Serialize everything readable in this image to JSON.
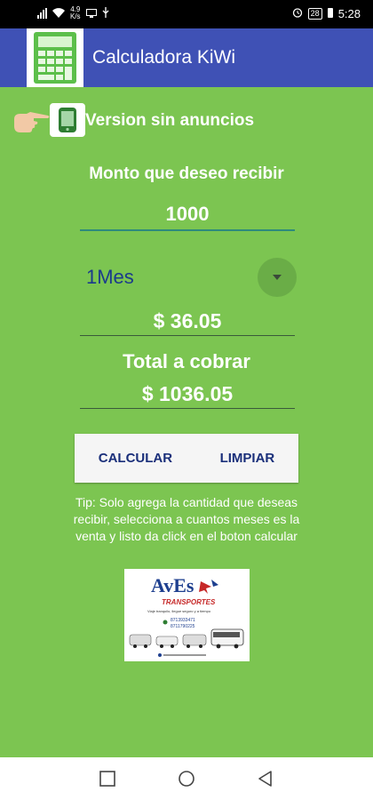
{
  "status_bar": {
    "netspeed_value": "4.9",
    "netspeed_unit": "K/s",
    "battery": "28",
    "time": "5:28"
  },
  "app_bar": {
    "title": "Calculadora KiWi",
    "color": "#3f51b5",
    "icon": "calculator-icon"
  },
  "ad_free": {
    "label": "Version sin anuncios",
    "icons": [
      "pointing-hand-icon",
      "phone-icon"
    ]
  },
  "form": {
    "amount_label": "Monto que deseo recibir",
    "amount_value": "1000",
    "months_selected": "1Mes",
    "interest": "$ 36.05",
    "total_label": "Total a cobrar",
    "total": "$ 1036.05"
  },
  "buttons": {
    "calculate": "CALCULAR",
    "clear": "LIMPIAR"
  },
  "tip": "Tip: Solo agrega la cantidad que deseas recibir, selecciona a cuantos meses es la venta y listo da click en el boton calcular",
  "banner": {
    "brand": "AvEs",
    "subtitle": "TRANSPORTES",
    "tagline": "Viaje tranquilo, llegue seguro y a tiempo",
    "phone_1": "8713933471",
    "phone_2": "8711790225"
  },
  "background_color": "#7cc551"
}
